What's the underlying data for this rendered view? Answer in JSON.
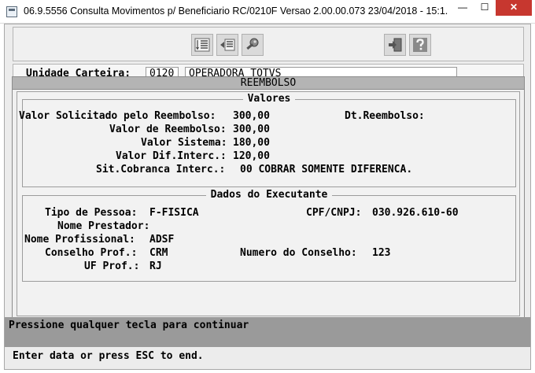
{
  "window": {
    "title": "06.9.5556 Consulta Movimentos p/ Beneficiario RC/0210F Versao 2.00.00.073 23/04/2018 - 15:1...",
    "minimize_glyph": "—",
    "maximize_glyph": "☐",
    "close_glyph": "✕"
  },
  "toolbar": {
    "icons": [
      "sort-list-icon",
      "list-arrow-icon",
      "search-key-icon",
      "exit-door-icon",
      "help-question-icon"
    ]
  },
  "header_fields": {
    "unidade_label": "Unidade Carteira:",
    "unidade_code": "0120",
    "unidade_name": "OPERADORA TOTVS"
  },
  "modal": {
    "title": "REEMBOLSO",
    "valores": {
      "legend": "Valores",
      "valor_solicitado_label": "Valor Solicitado pelo Reembolso:",
      "valor_solicitado": "300,00",
      "dt_reembolso_label": "Dt.Reembolso:",
      "dt_reembolso": "",
      "valor_reembolso_label": "Valor de Reembolso:",
      "valor_reembolso": "300,00",
      "valor_sistema_label": "Valor Sistema:",
      "valor_sistema": "180,00",
      "valor_dif_label": "Valor Dif.Interc.:",
      "valor_dif": "120,00",
      "sit_cobranca_label": "Sit.Cobranca Interc.:",
      "sit_cobranca": "00 COBRAR SOMENTE DIFERENCA."
    },
    "executante": {
      "legend": "Dados do Executante",
      "tipo_pessoa_label": "Tipo de Pessoa:",
      "tipo_pessoa": "F-FISICA",
      "cpf_label": "CPF/CNPJ:",
      "cpf": "030.926.610-60",
      "nome_prestador_label": "Nome Prestador:",
      "nome_prestador": "",
      "nome_profissional_label": "Nome Profissional:",
      "nome_profissional": "ADSF",
      "conselho_label": "Conselho Prof.:",
      "conselho": "CRM",
      "numero_conselho_label": "Numero do Conselho:",
      "numero_conselho": "123",
      "uf_label": "UF Prof.:",
      "uf": "RJ"
    }
  },
  "status": {
    "message": "Pressione qualquer tecla para continuar",
    "hint": "Enter data or press ESC to end."
  }
}
